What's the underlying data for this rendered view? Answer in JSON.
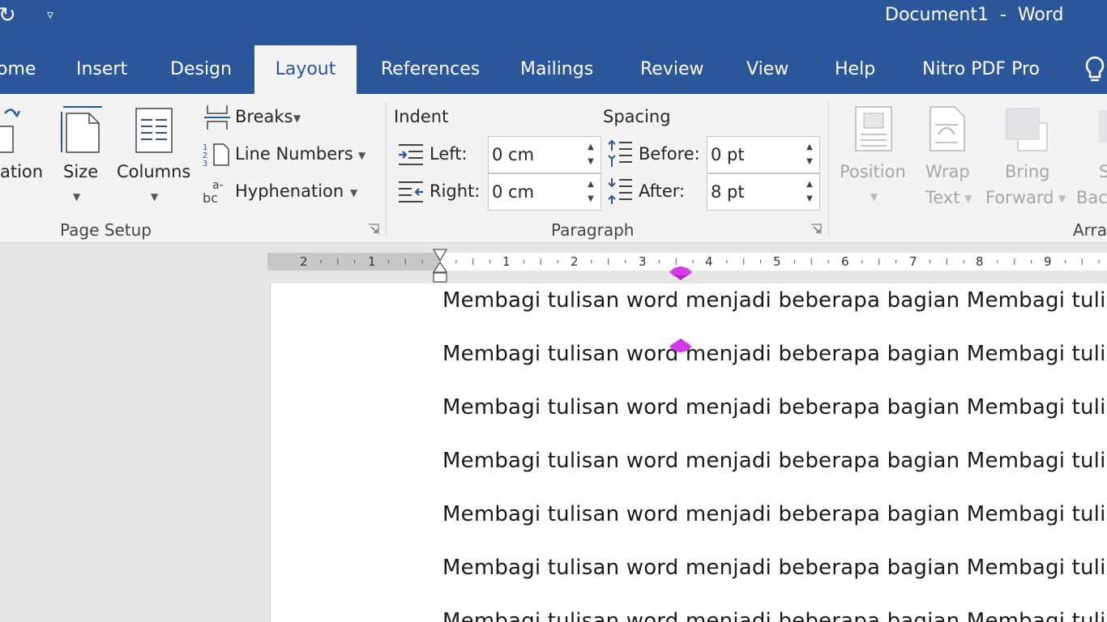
{
  "titlebar": {
    "title": "Document1  -  Word",
    "undo_icon": "undo-icon",
    "qat_icon": "customize-quick-access-icon"
  },
  "tabs": [
    {
      "label": "ome",
      "active": false
    },
    {
      "label": "Insert",
      "active": false
    },
    {
      "label": "Design",
      "active": false
    },
    {
      "label": "Layout",
      "active": true
    },
    {
      "label": "References",
      "active": false
    },
    {
      "label": "Mailings",
      "active": false
    },
    {
      "label": "Review",
      "active": false
    },
    {
      "label": "View",
      "active": false
    },
    {
      "label": "Help",
      "active": false
    },
    {
      "label": "Nitro PDF Pro",
      "active": false
    }
  ],
  "page_setup": {
    "orientation_label": "ation",
    "size_label": "Size",
    "columns_label": "Columns",
    "breaks_label": "Breaks",
    "line_numbers_label": "Line Numbers",
    "hyphenation_label": "Hyphenation",
    "group_label": "Page Setup"
  },
  "paragraph": {
    "indent_heading": "Indent",
    "spacing_heading": "Spacing",
    "left_label": "Left:",
    "right_label": "Right:",
    "before_label": "Before:",
    "after_label": "After:",
    "left_value": "0 cm",
    "right_value": "0 cm",
    "before_value": "0 pt",
    "after_value": "8 pt",
    "group_label": "Paragraph"
  },
  "arrange": {
    "position_label": "Position",
    "wrap_label_1": "Wrap",
    "wrap_label_2": "Text",
    "bring_label_1": "Bring",
    "bring_label_2": "Forward",
    "send_label_1": "S",
    "send_label_2": "Bac",
    "group_label": "Arra"
  },
  "ruler": {
    "numbers": [
      "2",
      "1",
      "1",
      "2",
      "3",
      "4",
      "5",
      "6",
      "7",
      "8",
      "9"
    ]
  },
  "document": {
    "paragraphs": [
      "Membagi tulisan word menjadi beberapa bagian Membagi tuli",
      "Membagi tulisan word menjadi beberapa bagian Membagi tuli",
      "Membagi tulisan word menjadi beberapa bagian Membagi tuli",
      "Membagi tulisan word menjadi beberapa bagian Membagi tuli",
      "Membagi tulisan word menjadi beberapa bagian Membagi tuli",
      "Membagi tulisan word menjadi beberapa bagian Membagi tuli",
      "Membagi tulisan word menjadi beberapa bagian Membagi tuli"
    ]
  },
  "colors": {
    "brand": "#2b579a",
    "ribbon": "#f3f3f3",
    "marker": "#d63be8"
  }
}
